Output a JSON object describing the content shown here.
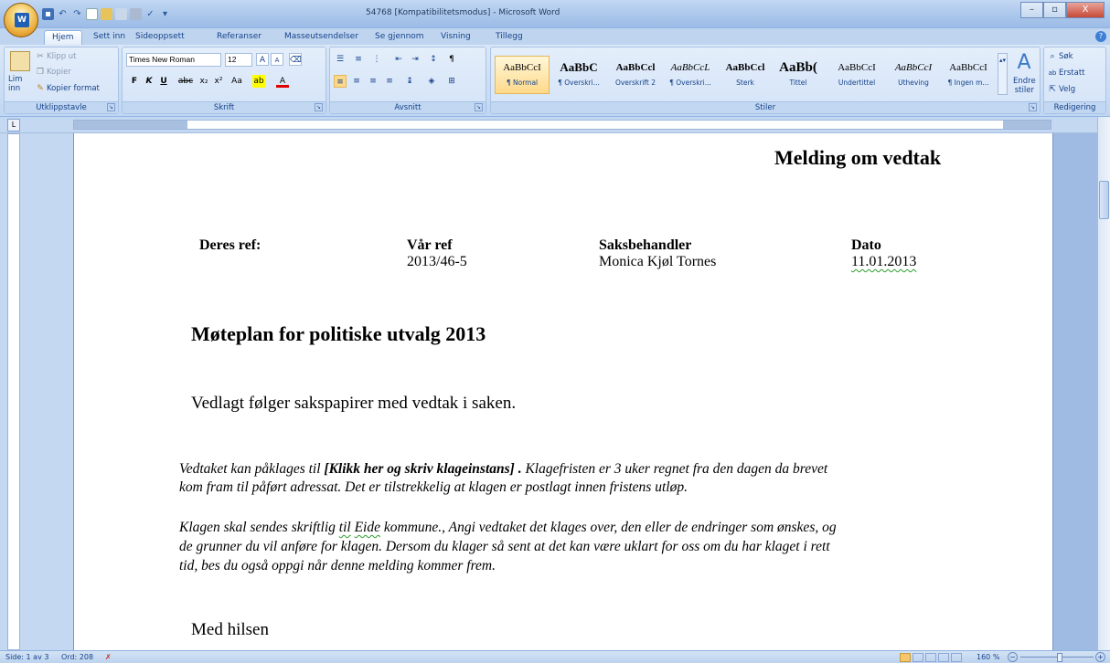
{
  "window": {
    "title": "54768 [Kompatibilitetsmodus] - Microsoft Word",
    "minimize": "–",
    "maximize": "▫",
    "close": "X"
  },
  "tabs": [
    "Hjem",
    "Sett inn",
    "Sideoppsett",
    "Referanser",
    "Masseutsendelser",
    "Se gjennom",
    "Visning",
    "Tillegg"
  ],
  "ribbon": {
    "clipboard": {
      "label": "Utklippstavle",
      "paste": "Lim\ninn",
      "cut": "Klipp ut",
      "copy": "Kopier",
      "format_painter": "Kopier format"
    },
    "font": {
      "label": "Skrift",
      "family": "Times New Roman",
      "size": "12"
    },
    "paragraph": {
      "label": "Avsnitt"
    },
    "styles": {
      "label": "Stiler",
      "items": [
        {
          "preview": "AaBbCcI",
          "name": "¶ Normal"
        },
        {
          "preview": "AaBbC",
          "name": "¶ Overskri..."
        },
        {
          "preview": "AaBbCcl",
          "name": "Overskrift 2"
        },
        {
          "preview": "AaBbCcL",
          "name": "¶ Overskri..."
        },
        {
          "preview": "AaBbCcl",
          "name": "Sterk"
        },
        {
          "preview": "AaBb(",
          "name": "Tittel"
        },
        {
          "preview": "AaBbCcI",
          "name": "Undertittel"
        },
        {
          "preview": "AaBbCcI",
          "name": "Utheving"
        },
        {
          "preview": "AaBbCcI",
          "name": "¶ Ingen m..."
        }
      ],
      "change_styles": "Endre\nstiler"
    },
    "editing": {
      "label": "Redigering",
      "find": "Søk",
      "replace": "Erstatt",
      "select": "Velg"
    }
  },
  "document": {
    "heading_right": "Melding om vedtak",
    "ref_headers": [
      "Deres ref:",
      "Vår ref",
      "Saksbehandler",
      "Dato"
    ],
    "ref_values": [
      "",
      "2013/46-5",
      "Monica Kjøl Tornes",
      "11.01.2013"
    ],
    "title": "Møteplan for politiske utvalg 2013",
    "intro": "Vedlagt følger sakspapirer med vedtak i saken.",
    "para1_a": "Vedtaket kan påklages til ",
    "para1_b": "[Klikk her og skriv klageinstans] .",
    "para1_c": " Klagefristen er 3 uker regnet fra den dagen da brevet",
    "para1_line2": "kom fram til påført adressat. Det er tilstrekkelig at klagen er postlagt innen fristens utløp.",
    "para2_line1_a": "Klagen skal sendes skriftlig ",
    "para2_til": "til",
    "para2_sp": " ",
    "para2_eide": "Eide",
    "para2_line1_b": " kommune., Angi vedtaket det klages over, den eller de endringer som ønskes, og",
    "para2_line2": "de grunner du vil anføre for klagen. Dersom du klager så sent at det kan være uklart for oss om du har klaget i rett",
    "para2_line3": "tid, bes du også oppgi når denne melding kommer frem.",
    "closing": "Med hilsen"
  },
  "statusbar": {
    "page": "Side: 1 av 3",
    "words": "Ord: 208",
    "zoom": "160 %"
  }
}
